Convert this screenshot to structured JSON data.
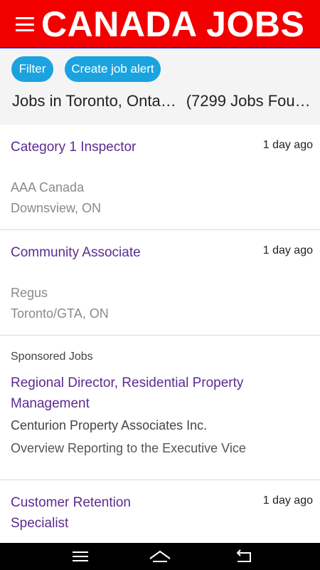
{
  "app": {
    "title": "CANADA JOBS"
  },
  "filters": {
    "filter_label": "Filter",
    "create_alert_label": "Create job alert",
    "location_text": "Jobs in Toronto, Onta…",
    "count_text": "(7299 Jobs Fou…"
  },
  "jobs": [
    {
      "title": "Category 1 Inspector",
      "date": "1 day ago",
      "company": "AAA Canada",
      "location": "Downsview, ON"
    },
    {
      "title": "Community Associate",
      "date": "1 day ago",
      "company": "Regus",
      "location": "Toronto/GTA, ON"
    },
    {
      "title": "Customer Retention Specialist",
      "date": "1 day ago"
    }
  ],
  "sponsored": {
    "label": "Sponsored Jobs",
    "title": "Regional Director, Residential Property Management",
    "company": "Centurion Property Associates Inc.",
    "description": "Overview Reporting to the Executive Vice"
  },
  "navbar": {
    "icons": [
      "menu-icon",
      "home-icon",
      "back-icon"
    ]
  },
  "colors": {
    "header": "#f20000",
    "pill": "#1aa3df",
    "job_title": "#5c2b91"
  }
}
